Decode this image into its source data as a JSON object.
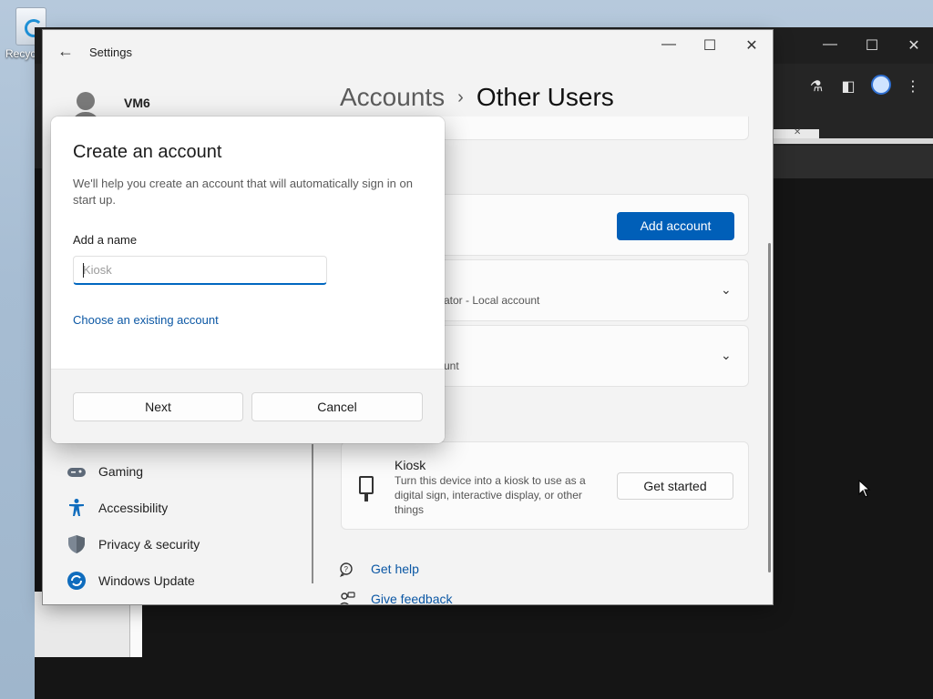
{
  "desktop": {
    "recycle_label": "Recyc"
  },
  "browser": {
    "minimize": "—",
    "maximize": "☐",
    "close": "✕",
    "tab_close": "✕"
  },
  "settings": {
    "title": "Settings",
    "user": {
      "name": "VM6"
    },
    "breadcrumb": {
      "parent": "Accounts",
      "separator": "›",
      "current": "Other Users"
    },
    "add_account_label": "Add account",
    "rows": [
      {
        "subtitle": "ator - Local account"
      },
      {
        "subtitle": "unt"
      }
    ],
    "nav": [
      {
        "label": "Gaming",
        "icon": "gamepad-icon"
      },
      {
        "label": "Accessibility",
        "icon": "accessibility-icon"
      },
      {
        "label": "Privacy & security",
        "icon": "shield-icon"
      },
      {
        "label": "Windows Update",
        "icon": "update-icon"
      }
    ],
    "kiosk": {
      "title": "Kiosk",
      "description": "Turn this device into a kiosk to use as a digital sign, interactive display, or other things",
      "button": "Get started"
    },
    "links": {
      "get_help": "Get help",
      "give_feedback": "Give feedback"
    },
    "window_controls": {
      "minimize": "—",
      "maximize": "☐",
      "close": "✕"
    }
  },
  "dialog": {
    "title": "Create an account",
    "description": "We'll help you create an account that will automatically sign in on start up.",
    "name_label": "Add a name",
    "name_value": "",
    "name_placeholder": "Kiosk",
    "existing_link": "Choose an existing account",
    "next_label": "Next",
    "cancel_label": "Cancel"
  },
  "colors": {
    "accent": "#005fb8",
    "link": "#0b57a4"
  }
}
